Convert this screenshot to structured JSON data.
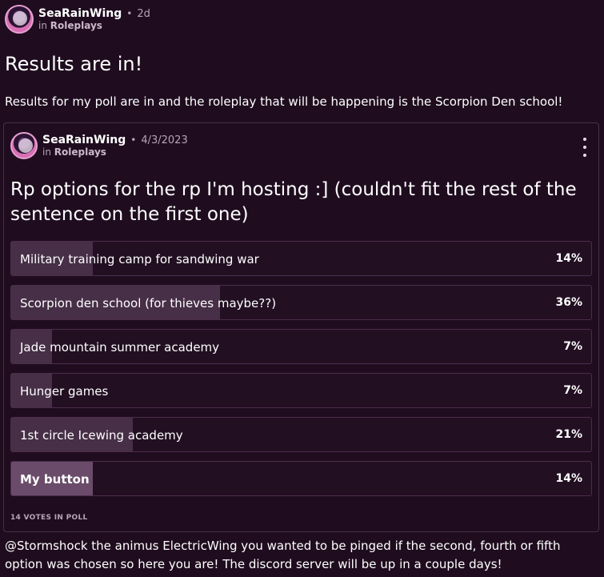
{
  "post": {
    "author": "SeaRainWing",
    "time": "2d",
    "community_prefix": "in",
    "community": "Roleplays",
    "title": "Results are in!",
    "body": "Results for my poll are in and the roleplay that will be happening is the Scorpion Den school!",
    "footer": "@Stormshock the animus ElectricWing you wanted to be pinged if the second, fourth or fifth option was chosen so here you are! The discord server will be up in a couple days!"
  },
  "embed": {
    "author": "SeaRainWing",
    "date": "4/3/2023",
    "community_prefix": "in",
    "community": "Roleplays",
    "title": "Rp options for the rp I'm hosting :] (couldn't fit the rest of the sentence on the first one)",
    "poll": {
      "options": [
        {
          "label": "Military training camp for sandwing war",
          "percent_text": "14%",
          "percent": 14,
          "selected": false
        },
        {
          "label": "Scorpion den school (for thieves maybe??)",
          "percent_text": "36%",
          "percent": 36,
          "selected": false
        },
        {
          "label": "Jade mountain summer academy",
          "percent_text": "7%",
          "percent": 7,
          "selected": false
        },
        {
          "label": "Hunger games",
          "percent_text": "7%",
          "percent": 7,
          "selected": false
        },
        {
          "label": "1st circle Icewing academy",
          "percent_text": "21%",
          "percent": 21,
          "selected": false
        },
        {
          "label": "My button",
          "percent_text": "14%",
          "percent": 14,
          "selected": true
        }
      ],
      "votes_text": "14 VOTES IN POLL"
    }
  },
  "icons": {
    "avatar": "avatar-icon",
    "more": "more-vertical-icon"
  }
}
